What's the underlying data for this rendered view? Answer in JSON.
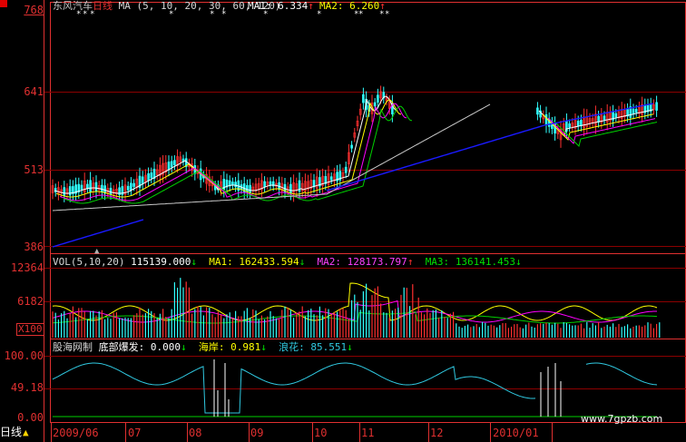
{
  "header": {
    "stock_name": "东风汽车",
    "period": "日线",
    "ma_def": "MA (5, 10, 20, 30, 60, 120)",
    "ma1_label": "MA1:",
    "ma1_value": "6.334",
    "ma1_arrow": "↑",
    "ma2_label": "MA2:",
    "ma2_value": "6.260",
    "ma2_arrow": "↑"
  },
  "price_axis": {
    "top": "768",
    "t641": "641",
    "t513": "513",
    "t386": "386"
  },
  "vol": {
    "title": "VOL(5,10,20)",
    "value": "115139.000",
    "value_arrow": "↓",
    "ma1_label": "MA1:",
    "ma1_value": "162433.594",
    "ma1_arrow": "↓",
    "ma2_label": "MA2:",
    "ma2_value": "128173.797",
    "ma2_arrow": "↑",
    "ma3_label": "MA3:",
    "ma3_value": "136141.453",
    "ma3_arrow": "↓",
    "axis_top": "12364",
    "axis_mid": "6182",
    "unit": "X100"
  },
  "indicator": {
    "name": "股海网制",
    "l1_label": "底部爆发:",
    "l1_value": "0.000",
    "l1_arrow": "↓",
    "l2_label": "海岸:",
    "l2_value": "0.981",
    "l2_arrow": "↓",
    "l3_label": "浪花:",
    "l3_value": "85.551",
    "l3_arrow": "↓",
    "axis_top": "100.00",
    "axis_mid": "49.18",
    "axis_bot": "0.00"
  },
  "x_axis": {
    "period_tab": "日线",
    "tab_glyph": "▲",
    "labels": [
      "2009/06",
      "07",
      "08",
      "09",
      "10",
      "11",
      "12",
      "2010/01"
    ]
  },
  "watermark": "www.7gpzb.com",
  "colors": {
    "axis_red": "#e03030",
    "grid_red": "#8b0000",
    "ma_white": "#ffffff",
    "ma_yellow": "#ffff00",
    "ma_magenta": "#ff00ff",
    "ma_green": "#00d000",
    "ma_gray": "#c8c8c8",
    "ma_blue": "#1a1aff",
    "cyan": "#30c8e0"
  }
}
